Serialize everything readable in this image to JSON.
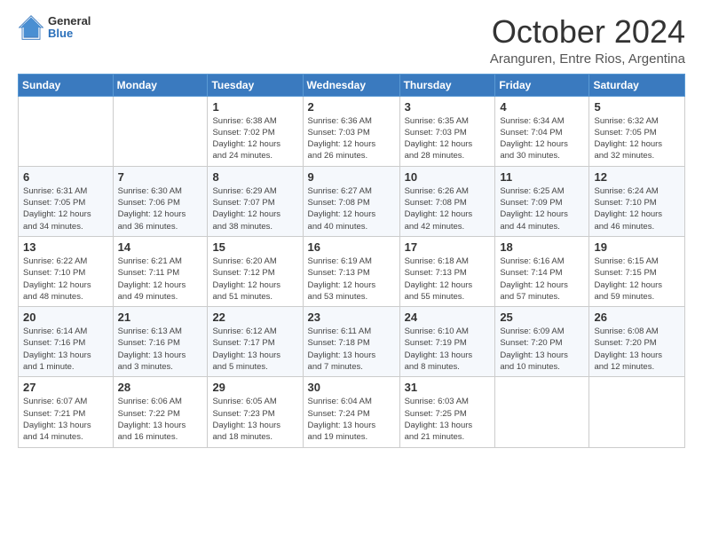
{
  "header": {
    "logo": {
      "general": "General",
      "blue": "Blue"
    },
    "title": "October 2024",
    "subtitle": "Aranguren, Entre Rios, Argentina"
  },
  "days_of_week": [
    "Sunday",
    "Monday",
    "Tuesday",
    "Wednesday",
    "Thursday",
    "Friday",
    "Saturday"
  ],
  "weeks": [
    [
      {
        "day": "",
        "info": ""
      },
      {
        "day": "",
        "info": ""
      },
      {
        "day": "1",
        "info": "Sunrise: 6:38 AM\nSunset: 7:02 PM\nDaylight: 12 hours\nand 24 minutes."
      },
      {
        "day": "2",
        "info": "Sunrise: 6:36 AM\nSunset: 7:03 PM\nDaylight: 12 hours\nand 26 minutes."
      },
      {
        "day": "3",
        "info": "Sunrise: 6:35 AM\nSunset: 7:03 PM\nDaylight: 12 hours\nand 28 minutes."
      },
      {
        "day": "4",
        "info": "Sunrise: 6:34 AM\nSunset: 7:04 PM\nDaylight: 12 hours\nand 30 minutes."
      },
      {
        "day": "5",
        "info": "Sunrise: 6:32 AM\nSunset: 7:05 PM\nDaylight: 12 hours\nand 32 minutes."
      }
    ],
    [
      {
        "day": "6",
        "info": "Sunrise: 6:31 AM\nSunset: 7:05 PM\nDaylight: 12 hours\nand 34 minutes."
      },
      {
        "day": "7",
        "info": "Sunrise: 6:30 AM\nSunset: 7:06 PM\nDaylight: 12 hours\nand 36 minutes."
      },
      {
        "day": "8",
        "info": "Sunrise: 6:29 AM\nSunset: 7:07 PM\nDaylight: 12 hours\nand 38 minutes."
      },
      {
        "day": "9",
        "info": "Sunrise: 6:27 AM\nSunset: 7:08 PM\nDaylight: 12 hours\nand 40 minutes."
      },
      {
        "day": "10",
        "info": "Sunrise: 6:26 AM\nSunset: 7:08 PM\nDaylight: 12 hours\nand 42 minutes."
      },
      {
        "day": "11",
        "info": "Sunrise: 6:25 AM\nSunset: 7:09 PM\nDaylight: 12 hours\nand 44 minutes."
      },
      {
        "day": "12",
        "info": "Sunrise: 6:24 AM\nSunset: 7:10 PM\nDaylight: 12 hours\nand 46 minutes."
      }
    ],
    [
      {
        "day": "13",
        "info": "Sunrise: 6:22 AM\nSunset: 7:10 PM\nDaylight: 12 hours\nand 48 minutes."
      },
      {
        "day": "14",
        "info": "Sunrise: 6:21 AM\nSunset: 7:11 PM\nDaylight: 12 hours\nand 49 minutes."
      },
      {
        "day": "15",
        "info": "Sunrise: 6:20 AM\nSunset: 7:12 PM\nDaylight: 12 hours\nand 51 minutes."
      },
      {
        "day": "16",
        "info": "Sunrise: 6:19 AM\nSunset: 7:13 PM\nDaylight: 12 hours\nand 53 minutes."
      },
      {
        "day": "17",
        "info": "Sunrise: 6:18 AM\nSunset: 7:13 PM\nDaylight: 12 hours\nand 55 minutes."
      },
      {
        "day": "18",
        "info": "Sunrise: 6:16 AM\nSunset: 7:14 PM\nDaylight: 12 hours\nand 57 minutes."
      },
      {
        "day": "19",
        "info": "Sunrise: 6:15 AM\nSunset: 7:15 PM\nDaylight: 12 hours\nand 59 minutes."
      }
    ],
    [
      {
        "day": "20",
        "info": "Sunrise: 6:14 AM\nSunset: 7:16 PM\nDaylight: 13 hours\nand 1 minute."
      },
      {
        "day": "21",
        "info": "Sunrise: 6:13 AM\nSunset: 7:16 PM\nDaylight: 13 hours\nand 3 minutes."
      },
      {
        "day": "22",
        "info": "Sunrise: 6:12 AM\nSunset: 7:17 PM\nDaylight: 13 hours\nand 5 minutes."
      },
      {
        "day": "23",
        "info": "Sunrise: 6:11 AM\nSunset: 7:18 PM\nDaylight: 13 hours\nand 7 minutes."
      },
      {
        "day": "24",
        "info": "Sunrise: 6:10 AM\nSunset: 7:19 PM\nDaylight: 13 hours\nand 8 minutes."
      },
      {
        "day": "25",
        "info": "Sunrise: 6:09 AM\nSunset: 7:20 PM\nDaylight: 13 hours\nand 10 minutes."
      },
      {
        "day": "26",
        "info": "Sunrise: 6:08 AM\nSunset: 7:20 PM\nDaylight: 13 hours\nand 12 minutes."
      }
    ],
    [
      {
        "day": "27",
        "info": "Sunrise: 6:07 AM\nSunset: 7:21 PM\nDaylight: 13 hours\nand 14 minutes."
      },
      {
        "day": "28",
        "info": "Sunrise: 6:06 AM\nSunset: 7:22 PM\nDaylight: 13 hours\nand 16 minutes."
      },
      {
        "day": "29",
        "info": "Sunrise: 6:05 AM\nSunset: 7:23 PM\nDaylight: 13 hours\nand 18 minutes."
      },
      {
        "day": "30",
        "info": "Sunrise: 6:04 AM\nSunset: 7:24 PM\nDaylight: 13 hours\nand 19 minutes."
      },
      {
        "day": "31",
        "info": "Sunrise: 6:03 AM\nSunset: 7:25 PM\nDaylight: 13 hours\nand 21 minutes."
      },
      {
        "day": "",
        "info": ""
      },
      {
        "day": "",
        "info": ""
      }
    ]
  ]
}
